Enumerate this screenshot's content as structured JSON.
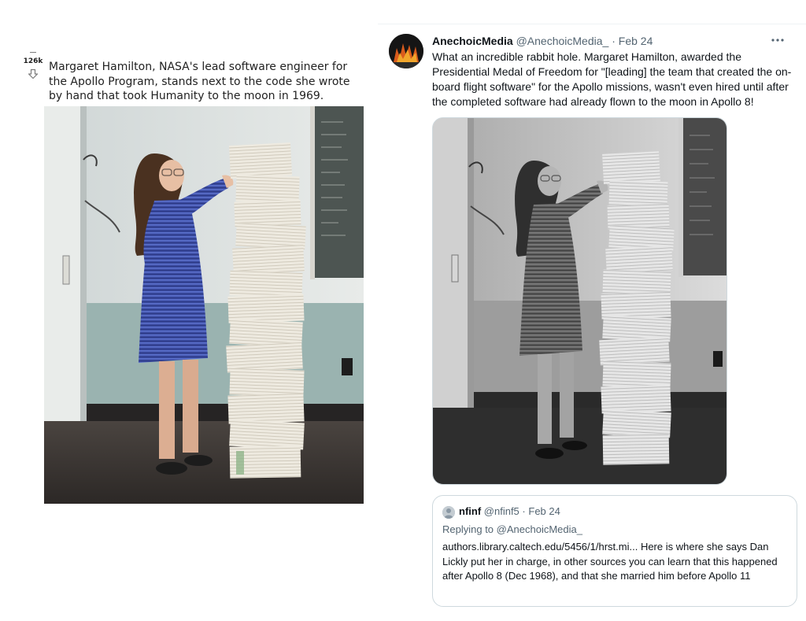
{
  "reddit": {
    "vote_count": "126k",
    "title": "Margaret Hamilton, NASA's lead software engineer for the Apollo Program, stands next to the code she wrote by hand that took Humanity to the moon in 1969.",
    "photo_alt": "Margaret Hamilton standing next to a tall stack of code listings",
    "icons": {
      "downvote": "arrow-down-icon"
    }
  },
  "tweet": {
    "author_name": "AnechoicMedia",
    "author_handle": "@AnechoicMedia_",
    "dot": "·",
    "date": "Feb 24",
    "text": "What an incredible rabbit hole. Margaret Hamilton, awarded the Presidential Medal of Freedom for \"[leading] the team that created the on-board flight software\" for the Apollo missions, wasn't even hired until after the completed software had already flown to the moon in Apollo 8!",
    "photo_alt": "Black and white photo of Margaret Hamilton next to a stack of code",
    "icons": {
      "more": "more-horizontal-icon",
      "avatar": "avatar-image"
    },
    "quote": {
      "name": "nfinf",
      "handle": "@nfinf5",
      "dot": "·",
      "date": "Feb 24",
      "replying_prefix": "Replying to ",
      "replying_to": "@AnechoicMedia_",
      "text": "authors.library.caltech.edu/5456/1/hrst.mi... Here is where she says Dan Lickly put her in charge, in other sources you can learn that this happened after Apollo 8 (Dec 1968), and that she married him before Apollo 11"
    }
  },
  "colors": {
    "text_primary": "#0f1419",
    "text_secondary": "#536471",
    "border": "#cfd9de"
  }
}
